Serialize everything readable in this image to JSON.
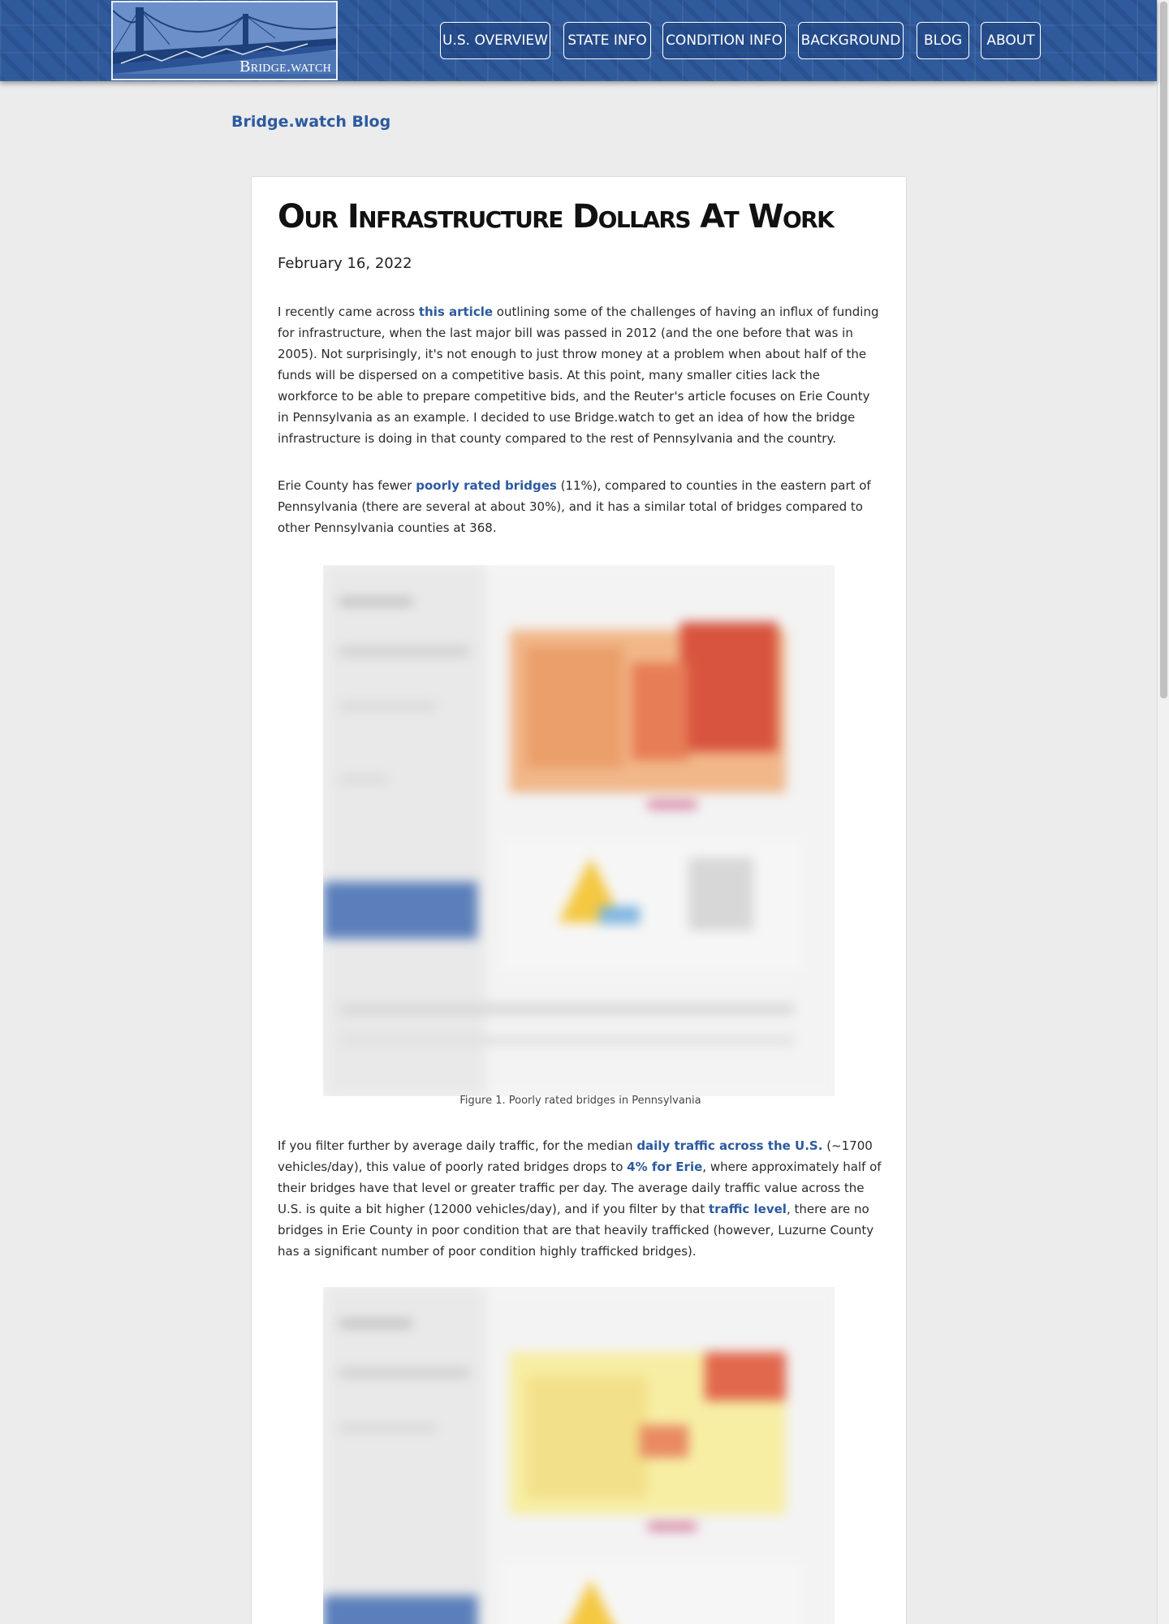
{
  "header": {
    "logo_text": "Bridge.watch",
    "nav": [
      {
        "label": "U.S. OVERVIEW"
      },
      {
        "label": "STATE INFO"
      },
      {
        "label": "CONDITION INFO"
      },
      {
        "label": "BACKGROUND"
      },
      {
        "label": "BLOG"
      },
      {
        "label": "ABOUT"
      }
    ]
  },
  "blog_link": "Bridge.watch Blog",
  "post": {
    "title": "Our Infrastructure Dollars At Work",
    "date": "February 16, 2022",
    "p1": {
      "t1": "I recently came across ",
      "link": "this article",
      "t2": " outlining some of the challenges of having an influx of funding for infrastructure, when the last major bill was passed in 2012 (and the one before that was in 2005). Not surprisingly, it's not enough to just throw money at a problem when about half of the funds will be dispersed on a competitive basis. At this point, many smaller cities lack the workforce to be able to prepare competitive bids, and the Reuter's article focuses on Erie County in Pennsylvania as an example. I decided to use Bridge.watch to get an idea of how the bridge infrastructure is doing in that county compared to the rest of Pennsylvania and the country."
    },
    "p2": {
      "t1": "Erie County has fewer ",
      "link": "poorly rated bridges",
      "t2": " (11%), compared to counties in the eastern part of Pennsylvania (there are several at about 30%), and it has a similar total of bridges compared to other Pennsylvania counties at 368."
    },
    "figure1_caption": "Figure 1. Poorly rated bridges in Pennsylvania",
    "p3": {
      "t1": "If you filter further by average daily traffic, for the median ",
      "link1": "daily traffic across the U.S.",
      "t2": " (~1700 vehicles/day), this value of poorly rated bridges drops to ",
      "link2": "4% for Erie",
      "t3": ", where approximately half of their bridges have that level or greater traffic per day. The average daily traffic value across the U.S. is quite a bit higher (12000 vehicles/day), and if you filter by that ",
      "link3": "traffic level",
      "t4": ", there are no bridges in Erie County in poor condition that are that heavily trafficked (however, Luzurne County has a significant number of poor condition highly trafficked bridges)."
    }
  }
}
